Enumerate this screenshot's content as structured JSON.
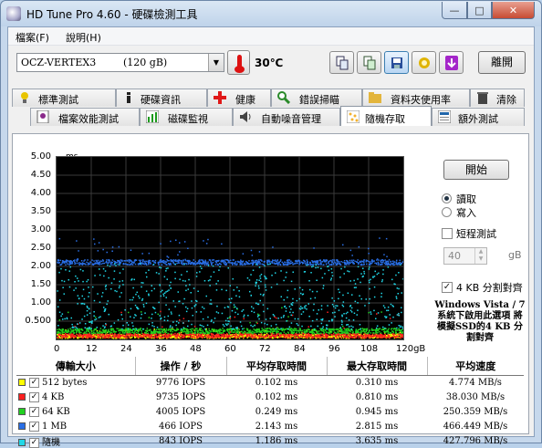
{
  "window": {
    "title": "HD Tune Pro 4.60 - 硬碟檢測工具",
    "min_glyph": "—",
    "max_glyph": "□",
    "close_glyph": "✕"
  },
  "menu": [
    "檔案(F)",
    "說明(H)"
  ],
  "toolbar": {
    "drive": "OCZ-VERTEX3",
    "capacity": "(120 gB)",
    "temperature": "30℃",
    "exit_label": "離開",
    "icons": [
      "copy-text-icon",
      "copy-screenshot-icon",
      "save-icon",
      "health-options-icon",
      "download-icon"
    ]
  },
  "tabs_row1": [
    {
      "label": "標準測試",
      "icon": "bulb-icon",
      "color": "#e8c400"
    },
    {
      "label": "硬碟資訊",
      "icon": "info-icon",
      "color": "#222222"
    },
    {
      "label": "健康",
      "icon": "health-cross-icon",
      "color": "#e01818"
    },
    {
      "label": "錯誤掃瞄",
      "icon": "magnifier-icon",
      "color": "#2a8a2a"
    },
    {
      "label": "資料夾使用率",
      "icon": "folder-icon",
      "color": "#e3b53c"
    },
    {
      "label": "清除",
      "icon": "trash-icon",
      "color": "#444444"
    }
  ],
  "tabs_row2": [
    {
      "label": "檔案效能測試",
      "icon": "file-bulb-icon",
      "color": "#8a2a8a"
    },
    {
      "label": "磁碟監視",
      "icon": "monitor-chart-icon",
      "color": "#1d9a1d"
    },
    {
      "label": "自動噪音管理",
      "icon": "speaker-icon",
      "color": "#444444"
    },
    {
      "label": "隨機存取",
      "icon": "random-dots-icon",
      "color": "#f3b230",
      "active": true
    },
    {
      "label": "額外測試",
      "icon": "extra-test-icon",
      "color": "#2266aa"
    }
  ],
  "controls": {
    "start_label": "開始",
    "read_label": "讀取",
    "write_label": "寫入",
    "read_selected": true,
    "short_test_label": "短程測試",
    "short_test_checked": false,
    "short_value": "40",
    "short_unit": "gB",
    "align_label": "4 KB 分割對齊",
    "align_checked": true,
    "note": "Windows Vista / 7 系統下啟用此選項 將模擬SSD的4 KB 分割對齊"
  },
  "chart_data": {
    "type": "scatter",
    "ylabel": "ms",
    "xlabel": "",
    "ylim": [
      0,
      5
    ],
    "xlim": [
      0,
      120
    ],
    "yticks": [
      "5.00",
      "4.50",
      "4.00",
      "3.50",
      "3.00",
      "2.50",
      "2.00",
      "1.50",
      "1.00",
      "0.500"
    ],
    "xticks": [
      "0",
      "12",
      "24",
      "36",
      "48",
      "60",
      "72",
      "84",
      "96",
      "108",
      "120gB"
    ],
    "series": [
      {
        "name": "512 bytes",
        "color": "#ffff00",
        "band": [
          0.05,
          0.16
        ],
        "outlier_max": 0.31
      },
      {
        "name": "4 KB",
        "color": "#ff2020",
        "band": [
          0.06,
          0.18
        ],
        "outlier_max": 0.81
      },
      {
        "name": "64 KB",
        "color": "#20d020",
        "band": [
          0.18,
          0.32
        ],
        "outlier_max": 0.94
      },
      {
        "name": "1 MB",
        "color": "#2a6fe6",
        "band": [
          2.06,
          2.2
        ],
        "outlier_max": 2.8
      },
      {
        "name": "隨機",
        "color": "#20d8e8",
        "band": [
          0.3,
          2.1
        ],
        "outlier_max": 3.6
      }
    ]
  },
  "results": {
    "headers": [
      "傳輸大小",
      "操作 / 秒",
      "平均存取時間",
      "最大存取時間",
      "平均速度"
    ],
    "rows": [
      {
        "size": "512 bytes",
        "iops": "9776 IOPS",
        "avg": "0.102 ms",
        "max": "0.310 ms",
        "speed": "4.774 MB/s",
        "color": "#ffff00"
      },
      {
        "size": "4 KB",
        "iops": "9735 IOPS",
        "avg": "0.102 ms",
        "max": "0.810 ms",
        "speed": "38.030 MB/s",
        "color": "#ff2020"
      },
      {
        "size": "64 KB",
        "iops": "4005 IOPS",
        "avg": "0.249 ms",
        "max": "0.945 ms",
        "speed": "250.359 MB/s",
        "color": "#20d020"
      },
      {
        "size": "1 MB",
        "iops": "466 IOPS",
        "avg": "2.143 ms",
        "max": "2.815 ms",
        "speed": "466.449 MB/s",
        "color": "#2a6fe6"
      },
      {
        "size": "隨機",
        "iops": "843 IOPS",
        "avg": "1.186 ms",
        "max": "3.635 ms",
        "speed": "427.796 MB/s",
        "color": "#20d8e8"
      }
    ]
  }
}
